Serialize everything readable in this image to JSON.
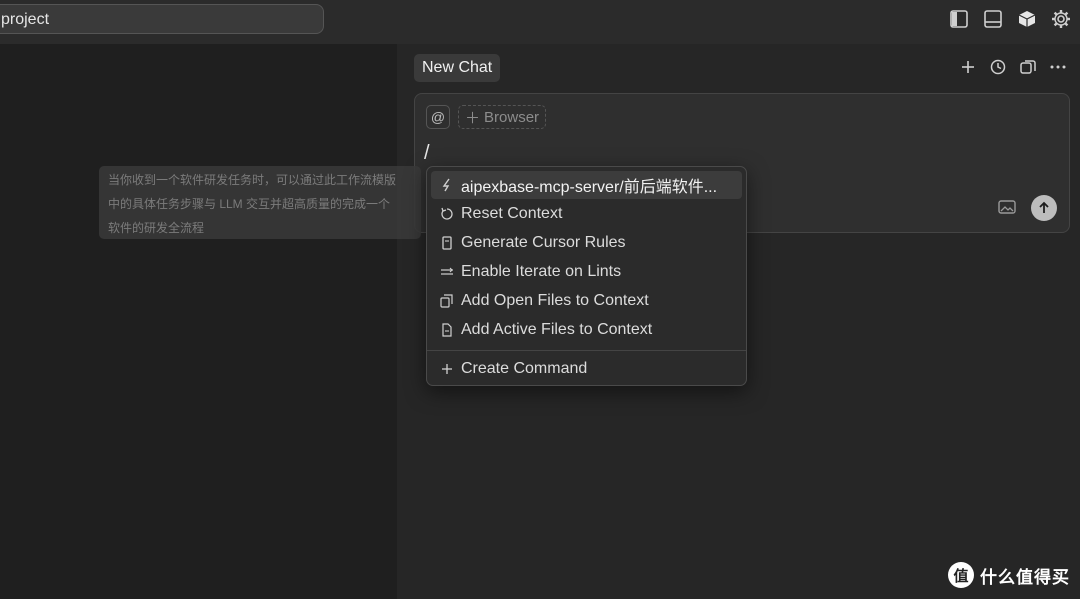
{
  "topbar": {
    "search_text": "project",
    "icons": [
      "sidebar-left-icon",
      "panel-bottom-icon",
      "cube-icon",
      "gear-icon"
    ]
  },
  "chat": {
    "tab_title": "New Chat",
    "actions": [
      "plus-icon",
      "history-icon",
      "copy-window-icon",
      "more-icon"
    ]
  },
  "composer": {
    "at_symbol": "@",
    "browser_label": "Browser",
    "input_value": "/"
  },
  "tooltip": {
    "lines": [
      "当你收到一个软件研发任务时，可以通过此工作流模版",
      "中的具体任务步骤与 LLM 交互并超高质量的完成一个",
      "软件的研发全流程"
    ]
  },
  "menu": {
    "items": [
      {
        "label": "aipexbase-mcp-server/前后端软件...",
        "icon": "lightning-icon",
        "active": true
      },
      {
        "label": "Reset Context",
        "icon": "reset-icon"
      },
      {
        "label": "Generate Cursor Rules",
        "icon": "rules-icon"
      },
      {
        "label": "Enable Iterate on Lints",
        "icon": "toggle-icon"
      },
      {
        "label": "Add Open Files to Context",
        "icon": "files-icon"
      },
      {
        "label": "Add Active Files to Context",
        "icon": "file-icon"
      }
    ],
    "create_label": "Create Command"
  },
  "watermark": {
    "logo_char": "值",
    "text": "什么值得买"
  }
}
